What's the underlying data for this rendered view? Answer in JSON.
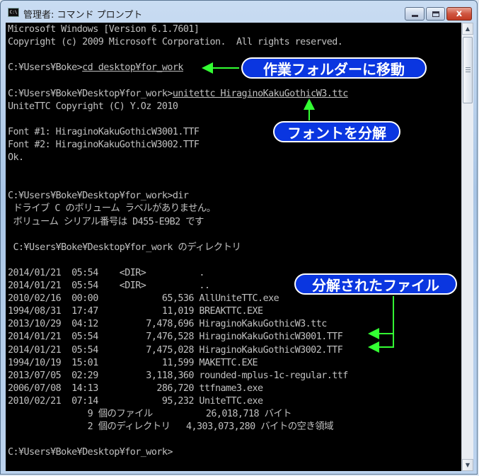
{
  "window": {
    "title": "管理者: コマンド プロンプト",
    "icon_text": "C:\\",
    "min_label": "",
    "max_label": "",
    "close_label": "x"
  },
  "console": {
    "lines": [
      "Microsoft Windows [Version 6.1.7601]",
      "Copyright (c) 2009 Microsoft Corporation.  All rights reserved.",
      "",
      "C:¥Users¥Boke>cd desktop¥for_work",
      "",
      "C:¥Users¥Boke¥Desktop¥for_work>unitettc HiraginoKakuGothicW3.ttc",
      "UniteTTC Copyright (C) Y.Oz 2010",
      "",
      "Font #1: HiraginoKakuGothicW3001.TTF",
      "Font #2: HiraginoKakuGothicW3002.TTF",
      "Ok.",
      "",
      "",
      "C:¥Users¥Boke¥Desktop¥for_work>dir",
      " ドライブ C のボリューム ラベルがありません。",
      " ボリューム シリアル番号は D455-E9B2 です",
      "",
      " C:¥Users¥Boke¥Desktop¥for_work のディレクトリ",
      "",
      "2014/01/21  05:54    <DIR>          .",
      "2014/01/21  05:54    <DIR>          ..",
      "2010/02/16  00:00            65,536 AllUniteTTC.exe",
      "1994/08/31  17:47            11,019 BREAKTTC.EXE",
      "2013/10/29  04:12         7,478,696 HiraginoKakuGothicW3.ttc",
      "2014/01/21  05:54         7,476,528 HiraginoKakuGothicW3001.TTF",
      "2014/01/21  05:54         7,475,028 HiraginoKakuGothicW3002.TTF",
      "1994/10/19  15:01            11,599 MAKETTC.EXE",
      "2013/07/05  02:29         3,118,360 rounded-mplus-1c-regular.ttf",
      "2006/07/08  14:13           286,720 ttfname3.exe",
      "2010/02/21  07:14            95,232 UniteTTC.exe",
      "               9 個のファイル          26,018,718 バイト",
      "               2 個のディレクトリ   4,303,073,280 バイトの空き領域",
      "",
      "C:¥Users¥Boke¥Desktop¥for_work>"
    ]
  },
  "callouts": {
    "move_folder": "作業フォルダーに移動",
    "split_font": "フォントを分解",
    "split_files": "分解されたファイル"
  },
  "colors": {
    "console_bg": "#000000",
    "console_text": "#c0c0c0",
    "callout_bg": "#0a36e0",
    "arrow": "#33ff33"
  }
}
